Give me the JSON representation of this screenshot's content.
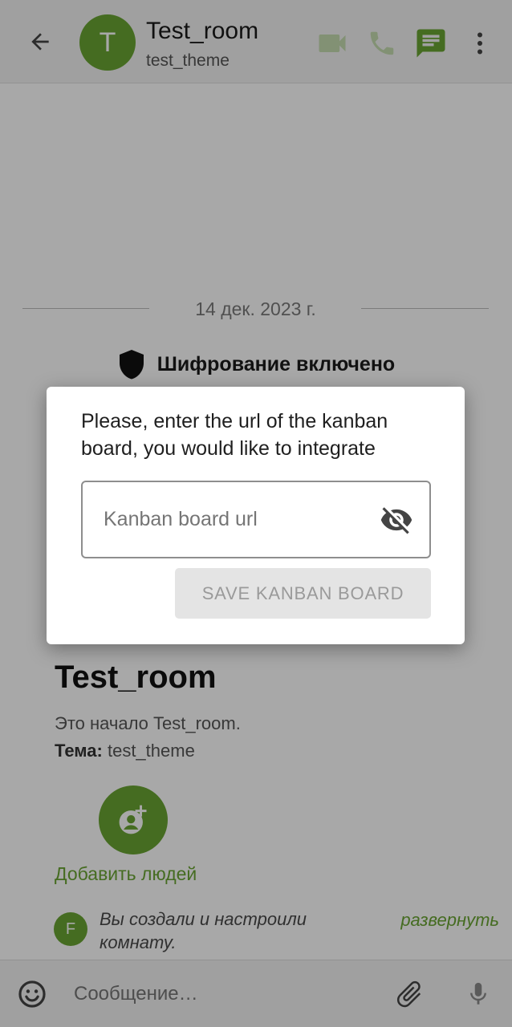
{
  "header": {
    "avatar_letter": "T",
    "title": "Test_room",
    "subtitle": "test_theme",
    "icons": [
      "back-arrow-icon",
      "video-call-icon",
      "phone-call-icon",
      "chat-icon",
      "more-vert-icon"
    ]
  },
  "timeline": {
    "date": "14 дек. 2023 г.",
    "encryption_notice": "Шифрование включено",
    "start_title": "Test_room",
    "start_desc": "Это начало Test_room.",
    "topic_label": "Тема:",
    "topic_value": "test_theme",
    "add_people_label": "Добавить людей",
    "event_avatar_letter": "F",
    "event_text": "Вы создали и настроили комнату.",
    "expand_label": "развернуть"
  },
  "composer": {
    "placeholder": "Сообщение…"
  },
  "dialog": {
    "message": "Please, enter the url of the kanban board, you would like to integrate",
    "input_placeholder": "Kanban board url",
    "input_value": "",
    "save_label": "SAVE KANBAN BOARD"
  },
  "colors": {
    "accent": "#6aa533",
    "scrim": "rgba(0,0,0,0.34)",
    "button_disabled_bg": "#e4e4e4",
    "button_disabled_text": "#9a9a9a"
  }
}
